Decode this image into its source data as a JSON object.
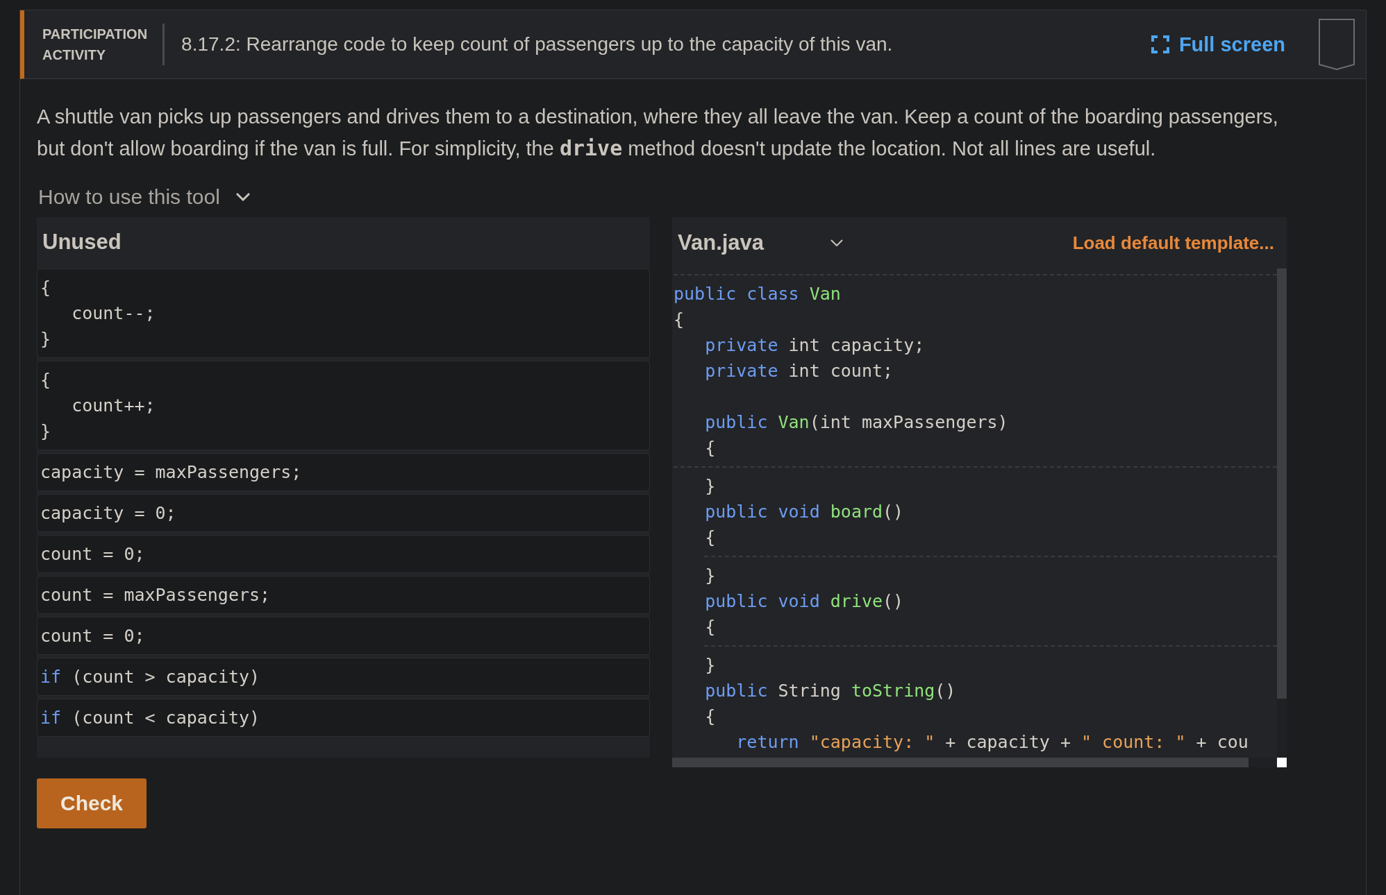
{
  "header": {
    "label_lines": [
      "PARTICIPATION",
      "ACTIVITY"
    ],
    "title": "8.17.2: Rearrange code to keep count of passengers up to the capacity of this van.",
    "full_screen": "Full screen"
  },
  "description": {
    "before": "A shuttle van picks up passengers and drives them to a destination, where they all leave the van. Keep a count of the boarding passengers, but don't allow boarding if the van is full. For simplicity, the ",
    "code": "drive",
    "after": " method doesn't update the location. Not all lines are useful."
  },
  "help_toggle": {
    "label": "How to use this tool",
    "expanded": false
  },
  "unused": {
    "title": "Unused",
    "blocks": [
      {
        "lines": [
          [
            {
              "text": "{",
              "kind": "plain"
            }
          ],
          [
            {
              "text": "   count--;",
              "kind": "plain"
            }
          ],
          [
            {
              "text": "}",
              "kind": "plain"
            }
          ]
        ]
      },
      {
        "lines": [
          [
            {
              "text": "{",
              "kind": "plain"
            }
          ],
          [
            {
              "text": "   count++;",
              "kind": "plain"
            }
          ],
          [
            {
              "text": "}",
              "kind": "plain"
            }
          ]
        ]
      },
      {
        "lines": [
          [
            {
              "text": "capacity = maxPassengers;",
              "kind": "plain"
            }
          ]
        ]
      },
      {
        "lines": [
          [
            {
              "text": "capacity = 0;",
              "kind": "plain"
            }
          ]
        ]
      },
      {
        "lines": [
          [
            {
              "text": "count = 0;",
              "kind": "plain"
            }
          ]
        ]
      },
      {
        "lines": [
          [
            {
              "text": "count = maxPassengers;",
              "kind": "plain"
            }
          ]
        ]
      },
      {
        "lines": [
          [
            {
              "text": "count = 0;",
              "kind": "plain"
            }
          ]
        ]
      },
      {
        "lines": [
          [
            {
              "text": "if",
              "kind": "keyword"
            },
            {
              "text": " (count > capacity)",
              "kind": "plain"
            }
          ]
        ]
      },
      {
        "lines": [
          [
            {
              "text": "if",
              "kind": "keyword"
            },
            {
              "text": " (count < capacity)",
              "kind": "plain"
            }
          ]
        ]
      }
    ]
  },
  "editor": {
    "file": "Van.java",
    "load_template": "Load default template...",
    "items": [
      {
        "kind": "drop",
        "nested": false
      },
      {
        "kind": "line",
        "tokens": [
          {
            "text": "public class ",
            "kind": "keyword"
          },
          {
            "text": "Van",
            "kind": "name"
          }
        ]
      },
      {
        "kind": "line",
        "tokens": [
          {
            "text": "{",
            "kind": "plain"
          }
        ]
      },
      {
        "kind": "line",
        "tokens": [
          {
            "text": "   private",
            "kind": "keyword"
          },
          {
            "text": " int capacity;",
            "kind": "plain"
          }
        ]
      },
      {
        "kind": "line",
        "tokens": [
          {
            "text": "   private",
            "kind": "keyword"
          },
          {
            "text": " int count;",
            "kind": "plain"
          }
        ]
      },
      {
        "kind": "blank"
      },
      {
        "kind": "line",
        "tokens": [
          {
            "text": "   public ",
            "kind": "keyword"
          },
          {
            "text": "Van",
            "kind": "name"
          },
          {
            "text": "(int maxPassengers)",
            "kind": "plain"
          }
        ]
      },
      {
        "kind": "line",
        "tokens": [
          {
            "text": "   {",
            "kind": "plain"
          }
        ]
      },
      {
        "kind": "drop",
        "nested": false
      },
      {
        "kind": "line",
        "tokens": [
          {
            "text": "   }",
            "kind": "plain"
          }
        ]
      },
      {
        "kind": "line",
        "tokens": [
          {
            "text": "   public void ",
            "kind": "keyword"
          },
          {
            "text": "board",
            "kind": "name"
          },
          {
            "text": "()",
            "kind": "plain"
          }
        ]
      },
      {
        "kind": "line",
        "tokens": [
          {
            "text": "   {",
            "kind": "plain"
          }
        ]
      },
      {
        "kind": "drop",
        "nested": true
      },
      {
        "kind": "line",
        "tokens": [
          {
            "text": "   }",
            "kind": "plain"
          }
        ]
      },
      {
        "kind": "line",
        "tokens": [
          {
            "text": "   public void ",
            "kind": "keyword"
          },
          {
            "text": "drive",
            "kind": "name"
          },
          {
            "text": "()",
            "kind": "plain"
          }
        ]
      },
      {
        "kind": "line",
        "tokens": [
          {
            "text": "   {",
            "kind": "plain"
          }
        ]
      },
      {
        "kind": "drop",
        "nested": true
      },
      {
        "kind": "line",
        "tokens": [
          {
            "text": "   }",
            "kind": "plain"
          }
        ]
      },
      {
        "kind": "line",
        "tokens": [
          {
            "text": "   public",
            "kind": "keyword"
          },
          {
            "text": " String ",
            "kind": "plain"
          },
          {
            "text": "toString",
            "kind": "name"
          },
          {
            "text": "()",
            "kind": "plain"
          }
        ]
      },
      {
        "kind": "line",
        "tokens": [
          {
            "text": "   {",
            "kind": "plain"
          }
        ]
      },
      {
        "kind": "line",
        "tokens": [
          {
            "text": "      return ",
            "kind": "keyword"
          },
          {
            "text": "\"capacity: \"",
            "kind": "string"
          },
          {
            "text": " + capacity + ",
            "kind": "plain"
          },
          {
            "text": "\" count: \"",
            "kind": "string"
          },
          {
            "text": " + cou",
            "kind": "plain"
          }
        ]
      }
    ]
  },
  "check_button": "Check"
}
